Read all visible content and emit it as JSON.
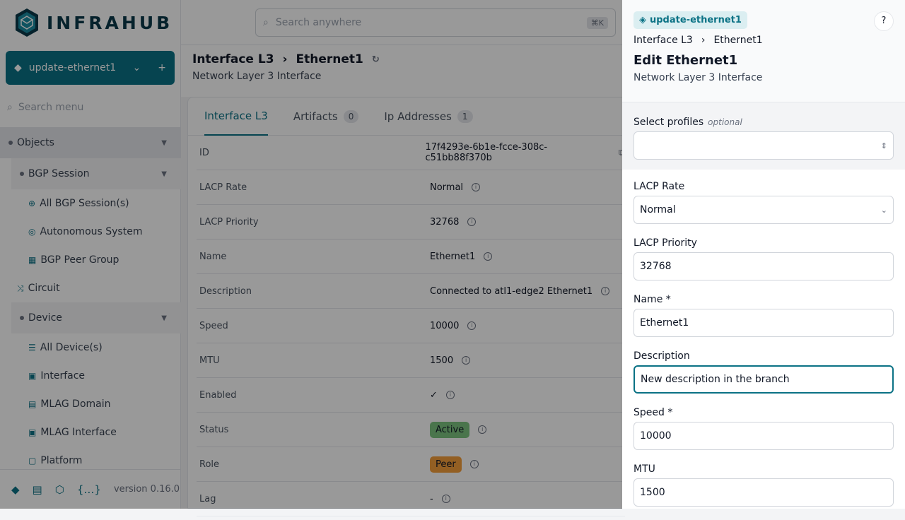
{
  "app": {
    "logo": "INFRAHUB",
    "version": "version 0.16.0"
  },
  "branch": {
    "name": "update-ethernet1"
  },
  "sidebar": {
    "search_placeholder": "Search menu",
    "items": [
      {
        "label": "Objects",
        "type": "sec"
      },
      {
        "label": "BGP Session",
        "type": "sub"
      },
      {
        "label": "All BGP Session(s)",
        "type": "leaf",
        "icon": "⊕"
      },
      {
        "label": "Autonomous System",
        "type": "leaf",
        "icon": "◎"
      },
      {
        "label": "BGP Peer Group",
        "type": "leaf",
        "icon": "▦"
      },
      {
        "label": "Circuit",
        "type": "top",
        "icon": "⤨"
      },
      {
        "label": "Device",
        "type": "sub"
      },
      {
        "label": "All Device(s)",
        "type": "leaf",
        "icon": "☰"
      },
      {
        "label": "Interface",
        "type": "leaf",
        "icon": "▣"
      },
      {
        "label": "MLAG Domain",
        "type": "leaf",
        "icon": "▤"
      },
      {
        "label": "MLAG Interface",
        "type": "leaf",
        "icon": "▣"
      },
      {
        "label": "Platform",
        "type": "leaf",
        "icon": "▢"
      }
    ]
  },
  "search": {
    "placeholder": "Search anywhere",
    "shortcut": "⌘K"
  },
  "page": {
    "crumb_type": "Interface L3",
    "crumb_name": "Ethernet1",
    "subtitle": "Network Layer 3 Interface"
  },
  "tabs": [
    {
      "label": "Interface L3"
    },
    {
      "label": "Artifacts",
      "count": "0"
    },
    {
      "label": "Ip Addresses",
      "count": "1"
    }
  ],
  "details": [
    {
      "label": "ID",
      "value": "17f4293e-6b1e-fcce-308c-c51bb88f370b"
    },
    {
      "label": "LACP Rate",
      "value": "Normal"
    },
    {
      "label": "LACP Priority",
      "value": "32768"
    },
    {
      "label": "Name",
      "value": "Ethernet1"
    },
    {
      "label": "Description",
      "value": "Connected to atl1-edge2 Ethernet1"
    },
    {
      "label": "Speed",
      "value": "10000"
    },
    {
      "label": "MTU",
      "value": "1500"
    },
    {
      "label": "Enabled",
      "value": "✓"
    },
    {
      "label": "Status",
      "value": "Active",
      "color": "#7cc47f"
    },
    {
      "label": "Role",
      "value": "Peer",
      "color": "#f59e3b"
    },
    {
      "label": "Lag",
      "value": "-"
    }
  ],
  "panel": {
    "branch": "update-ethernet1",
    "help": "?",
    "crumb_type": "Interface L3",
    "crumb_name": "Ethernet1",
    "title": "Edit Ethernet1",
    "subtitle": "Network Layer 3 Interface",
    "profiles_label": "Select profiles",
    "profiles_optional": "optional",
    "fields": [
      {
        "label": "LACP Rate",
        "value": "Normal",
        "kind": "select"
      },
      {
        "label": "LACP Priority",
        "value": "32768"
      },
      {
        "label": "Name *",
        "value": "Ethernet1"
      },
      {
        "label": "Description",
        "value": "New description in the branch",
        "focus": true
      },
      {
        "label": "Speed *",
        "value": "10000"
      },
      {
        "label": "MTU",
        "value": "1500"
      }
    ]
  },
  "colors": {
    "accent": "#0b7285"
  }
}
